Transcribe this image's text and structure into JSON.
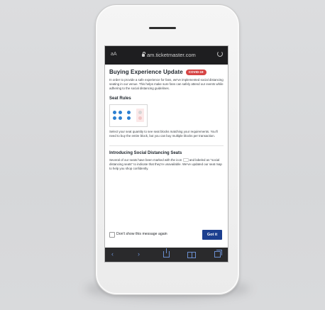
{
  "browser": {
    "text_size_label": "aA",
    "url": "am.ticketmaster.com"
  },
  "modal": {
    "title": "Buying Experience Update",
    "badge": "COVID-19",
    "intro": "In order to provide a safe experience for fans, we've implemented social distancing seating in our venue. This helps make sure fans can safely attend our events while adhering to the social distancing guidelines.",
    "seat_rules_heading": "Seat Rules",
    "seat_rules_text": "Select your seat quantity to see seat blocks matching your requirements. You'll need to buy the entire block, but you can buy multiple blocks per transaction.",
    "distancing_heading": "Introducing Social Distancing Seats",
    "distancing_text_1": "Several of our seats have been marked with the icon",
    "distancing_text_2": "and labeled as \"social distancing seats\" to indicate that they're unavailable. We've updated our seat map to help you shop confidently.",
    "dont_show_label": "Don't show this message again",
    "got_it_label": "Got it"
  },
  "colors": {
    "badge": "#d64545",
    "seat_available": "#2c7fd1",
    "seat_distanced": "#f1c6c6",
    "button": "#1c3f8f"
  },
  "toolbar_icons": [
    "back-icon",
    "forward-icon",
    "share-icon",
    "bookmarks-icon",
    "tabs-icon"
  ]
}
